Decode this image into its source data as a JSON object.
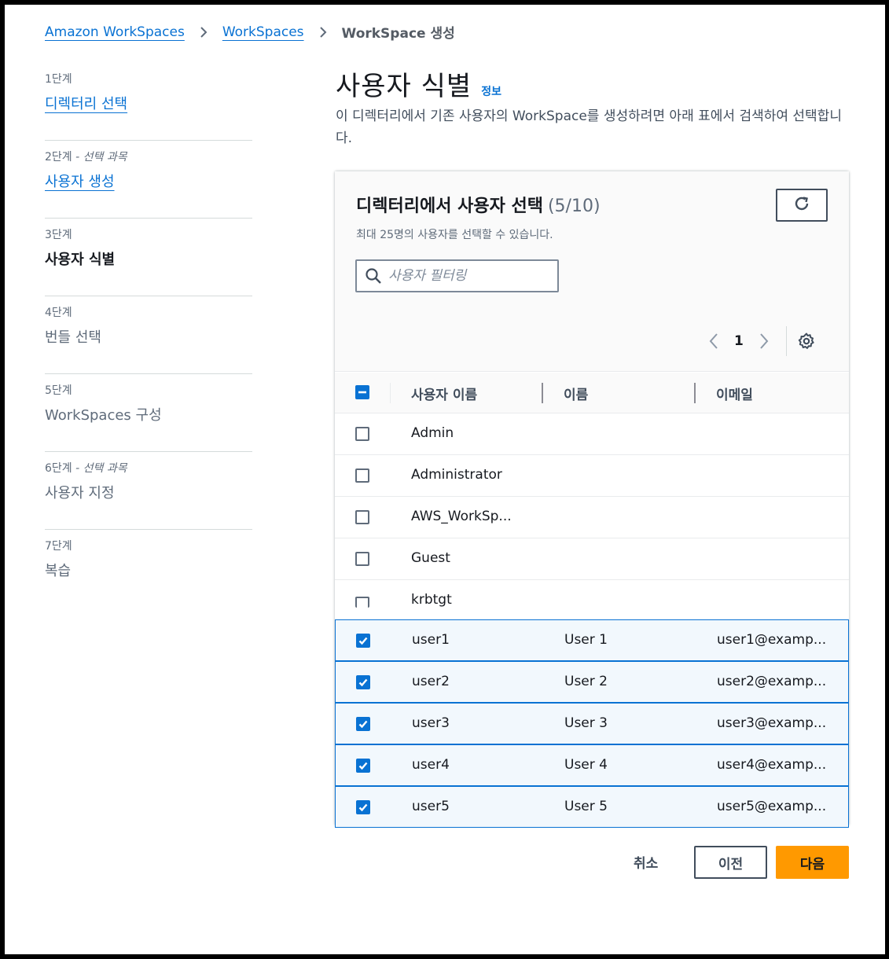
{
  "breadcrumb": {
    "items": [
      "Amazon WorkSpaces",
      "WorkSpaces"
    ],
    "current": "WorkSpace 생성"
  },
  "steps": [
    {
      "label": "1단계",
      "optional": "",
      "title": "디렉터리 선택",
      "state": "link"
    },
    {
      "label": "2단계",
      "optional": "- 선택 과목",
      "title": "사용자 생성",
      "state": "link"
    },
    {
      "label": "3단계",
      "optional": "",
      "title": "사용자 식별",
      "state": "active"
    },
    {
      "label": "4단계",
      "optional": "",
      "title": "번들 선택",
      "state": "disabled"
    },
    {
      "label": "5단계",
      "optional": "",
      "title": "WorkSpaces 구성",
      "state": "disabled"
    },
    {
      "label": "6단계",
      "optional": "- 선택 과목",
      "title": "사용자 지정",
      "state": "disabled"
    },
    {
      "label": "7단계",
      "optional": "",
      "title": "복습",
      "state": "disabled"
    }
  ],
  "page": {
    "title": "사용자 식별",
    "info": "정보",
    "description": "이 디렉터리에서 기존 사용자의 WorkSpace를 생성하려면 아래 표에서 검색하여 선택합니다."
  },
  "table": {
    "title": "디렉터리에서 사용자 선택",
    "count": "(5/10)",
    "description": "최대 25명의 사용자를 선택할 수 있습니다.",
    "filter_placeholder": "사용자 필터링",
    "page": "1",
    "columns": [
      "사용자 이름",
      "이름",
      "이메일"
    ],
    "rows": [
      {
        "username": "Admin",
        "name": "",
        "email": "",
        "selected": false
      },
      {
        "username": "Administrator",
        "name": "",
        "email": "",
        "selected": false
      },
      {
        "username": "AWS_WorkSp...",
        "name": "",
        "email": "",
        "selected": false
      },
      {
        "username": "Guest",
        "name": "",
        "email": "",
        "selected": false
      },
      {
        "username": "krbtgt",
        "name": "",
        "email": "",
        "selected": false
      },
      {
        "username": "user1",
        "name": "User 1",
        "email": "user1@examp...",
        "selected": true
      },
      {
        "username": "user2",
        "name": "User 2",
        "email": "user2@examp...",
        "selected": true
      },
      {
        "username": "user3",
        "name": "User 3",
        "email": "user3@examp...",
        "selected": true
      },
      {
        "username": "user4",
        "name": "User 4",
        "email": "user4@examp...",
        "selected": true
      },
      {
        "username": "user5",
        "name": "User 5",
        "email": "user5@examp...",
        "selected": true
      }
    ]
  },
  "actions": {
    "cancel": "취소",
    "previous": "이전",
    "next": "다음"
  },
  "colors": {
    "link": "#0972d3",
    "primary_button": "#ff9900",
    "selected_row_bg": "#f2f8fd"
  }
}
